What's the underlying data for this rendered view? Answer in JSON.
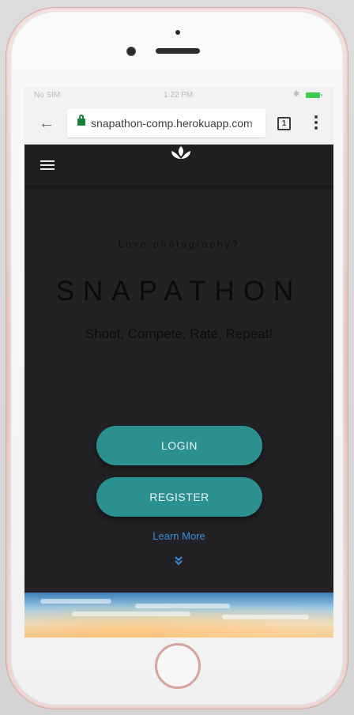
{
  "status_bar": {
    "carrier": "No SIM",
    "time": "1:22 PM",
    "battery_color": "#3dcb4d"
  },
  "browser": {
    "url": "snapathon-comp.herokuapp.com",
    "tab_count": "1",
    "icons": [
      "back-arrow-icon",
      "lock-icon",
      "tabs-icon",
      "menu-icon"
    ]
  },
  "site": {
    "header": {
      "icons": [
        "hamburger-icon",
        "lotus-logo-icon"
      ]
    },
    "hero": {
      "tagline": "Love photography?",
      "brand": "SNAPATHON",
      "subtitle": "Shoot, Compete, Rate, Repeat!",
      "login_label": "LOGIN",
      "register_label": "REGISTER",
      "learn_more_label": "Learn More"
    },
    "colors": {
      "background": "#222224",
      "button": "#2a9090",
      "link": "#3b8fd6"
    }
  }
}
